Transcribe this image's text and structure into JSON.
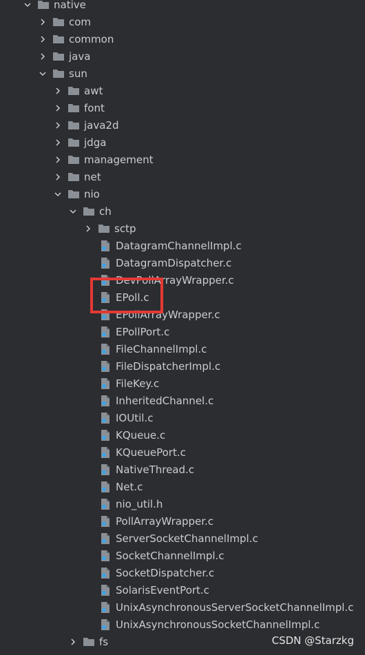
{
  "tree": {
    "native": "native",
    "com": "com",
    "common": "common",
    "java": "java",
    "sun": "sun",
    "awt": "awt",
    "font": "font",
    "java2d": "java2d",
    "jdga": "jdga",
    "management": "management",
    "net": "net",
    "nio": "nio",
    "ch": "ch",
    "sctp": "sctp",
    "files": [
      "DatagramChannelImpl.c",
      "DatagramDispatcher.c",
      "DevPollArrayWrapper.c",
      "EPoll.c",
      "EPollArrayWrapper.c",
      "EPollPort.c",
      "FileChannelImpl.c",
      "FileDispatcherImpl.c",
      "FileKey.c",
      "InheritedChannel.c",
      "IOUtil.c",
      "KQueue.c",
      "KQueuePort.c",
      "NativeThread.c",
      "Net.c",
      "nio_util.h",
      "PollArrayWrapper.c",
      "ServerSocketChannelImpl.c",
      "SocketChannelImpl.c",
      "SocketDispatcher.c",
      "SolarisEventPort.c",
      "UnixAsynchronousServerSocketChannelImpl.c",
      "UnixAsynchronousSocketChannelImpl.c"
    ],
    "fs": "fs"
  },
  "watermark": "CSDN @Starzkg",
  "colors": {
    "background": "#2b2d30",
    "text": "#c9ccd1",
    "folder": "#8b9097",
    "file_icon": "#8b9097",
    "file_badge": "#3fa2e5",
    "highlight": "#e53935"
  }
}
